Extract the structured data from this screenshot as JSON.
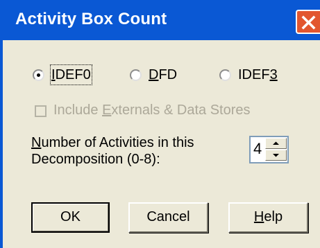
{
  "window": {
    "title": "Activity Box Count",
    "close_icon": "close-icon"
  },
  "notation": {
    "options": [
      {
        "label_prefix": "",
        "label_mnemonic": "I",
        "label_suffix": "DEF0",
        "selected": true
      },
      {
        "label_prefix": "",
        "label_mnemonic": "D",
        "label_suffix": "FD",
        "selected": false
      },
      {
        "label_prefix": "IDEF",
        "label_mnemonic": "3",
        "label_suffix": "",
        "selected": false
      }
    ]
  },
  "externals": {
    "label_prefix": "Include ",
    "label_mnemonic": "E",
    "label_suffix": "xternals & Data Stores",
    "checked": false,
    "enabled": false
  },
  "count": {
    "label_line1_mnemonic": "N",
    "label_line1_rest": "umber of Activities in this",
    "label_line2": "Decomposition (0-8):",
    "value": "4"
  },
  "buttons": {
    "ok": "OK",
    "cancel": "Cancel",
    "help_mnemonic": "H",
    "help_rest": "elp"
  }
}
